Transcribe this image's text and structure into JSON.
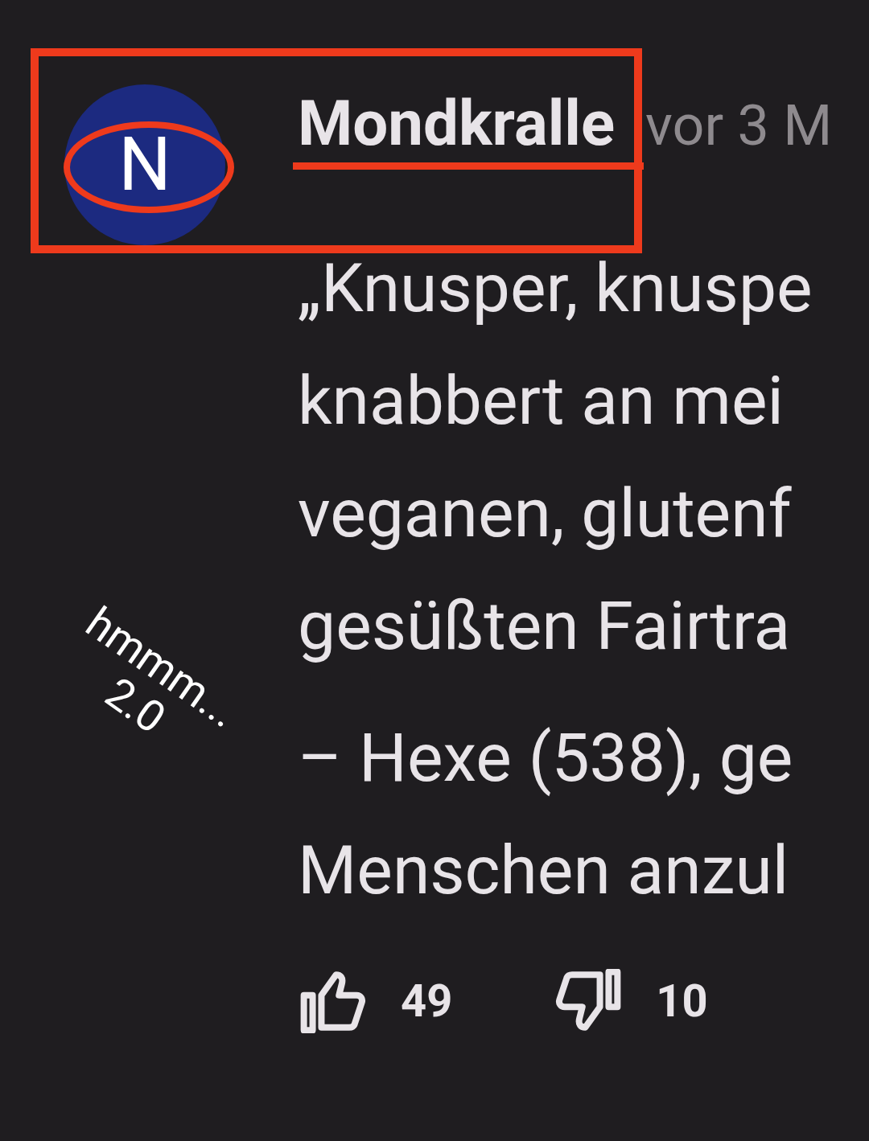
{
  "comment": {
    "avatar_letter": "N",
    "author": "Mondkralle",
    "time": "vor 3 M",
    "paragraphs": [
      [
        "„Knusper, knuspe",
        "knabbert an mei",
        "veganen, glutenf",
        "gesüßten Fairtra"
      ],
      [
        "– Hexe (538), ge",
        "Menschen anzul"
      ]
    ],
    "likes": "49",
    "dislikes": "10"
  },
  "annotations": {
    "note_lines": [
      "hmmm...",
      "2.0"
    ]
  }
}
